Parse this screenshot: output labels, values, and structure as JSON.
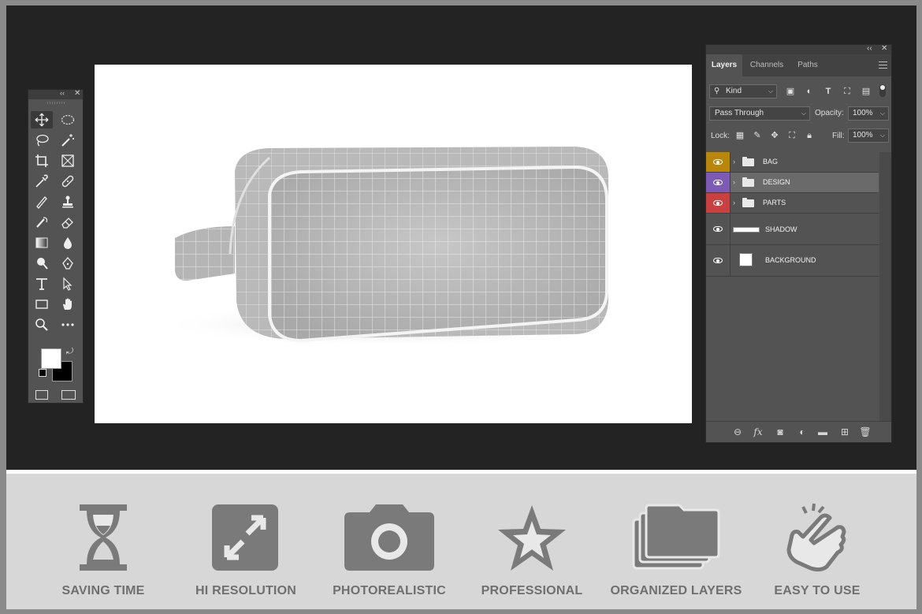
{
  "toolbar": {
    "tools": [
      {
        "name": "move-tool",
        "icon": "move-icon"
      },
      {
        "name": "elliptical-marquee-tool",
        "icon": "ellipse-marquee-icon"
      },
      {
        "name": "lasso-tool",
        "icon": "lasso-icon"
      },
      {
        "name": "magic-wand-tool",
        "icon": "magic-wand-icon"
      },
      {
        "name": "crop-tool",
        "icon": "crop-icon"
      },
      {
        "name": "frame-tool",
        "icon": "frame-icon"
      },
      {
        "name": "eyedropper-tool",
        "icon": "eyedropper-icon"
      },
      {
        "name": "healing-brush-tool",
        "icon": "bandage-icon"
      },
      {
        "name": "brush-tool",
        "icon": "brush-icon"
      },
      {
        "name": "clone-stamp-tool",
        "icon": "stamp-icon"
      },
      {
        "name": "history-brush-tool",
        "icon": "history-brush-icon"
      },
      {
        "name": "eraser-tool",
        "icon": "eraser-icon"
      },
      {
        "name": "gradient-tool",
        "icon": "gradient-icon"
      },
      {
        "name": "blur-tool",
        "icon": "drop-icon"
      },
      {
        "name": "dodge-tool",
        "icon": "dodge-icon"
      },
      {
        "name": "pen-tool",
        "icon": "pen-icon"
      },
      {
        "name": "type-tool",
        "icon": "type-icon"
      },
      {
        "name": "path-selection-tool",
        "icon": "arrow-icon"
      },
      {
        "name": "rectangle-tool",
        "icon": "rectangle-icon"
      },
      {
        "name": "hand-tool",
        "icon": "hand-icon"
      },
      {
        "name": "zoom-tool",
        "icon": "magnifier-icon"
      },
      {
        "name": "more-tools",
        "icon": "ellipsis-icon"
      }
    ]
  },
  "layers_panel": {
    "tabs": [
      "Layers",
      "Channels",
      "Paths"
    ],
    "active_tab": "Layers",
    "filter_kind": "Kind",
    "blend_mode": "Pass Through",
    "opacity_label": "Opacity:",
    "opacity_value": "100%",
    "lock_label": "Lock:",
    "fill_label": "Fill:",
    "fill_value": "100%",
    "layers": [
      {
        "name": "BAG",
        "type": "group",
        "color": "#b8860b"
      },
      {
        "name": "DESIGN",
        "type": "group",
        "color": "#7d5bb5",
        "selected": true
      },
      {
        "name": "PARTS",
        "type": "group",
        "color": "#c94040"
      },
      {
        "name": "SHADOW",
        "type": "layer",
        "color": ""
      },
      {
        "name": "BACKGROUND",
        "type": "layer",
        "color": ""
      }
    ]
  },
  "features": [
    {
      "label": "SAVING TIME",
      "icon": "hourglass-icon"
    },
    {
      "label": "HI RESOLUTION",
      "icon": "expand-icon"
    },
    {
      "label": "PHOTOREALISTIC",
      "icon": "camera-icon"
    },
    {
      "label": "PROFESSIONAL",
      "icon": "star-icon"
    },
    {
      "label": "ORGANIZED LAYERS",
      "icon": "folders-icon"
    },
    {
      "label": "EASY TO USE",
      "icon": "pointing-hand-icon"
    }
  ],
  "colors": {
    "workspace": "#232323",
    "panel": "#535353",
    "feature_gray": "#7a7a7a"
  }
}
